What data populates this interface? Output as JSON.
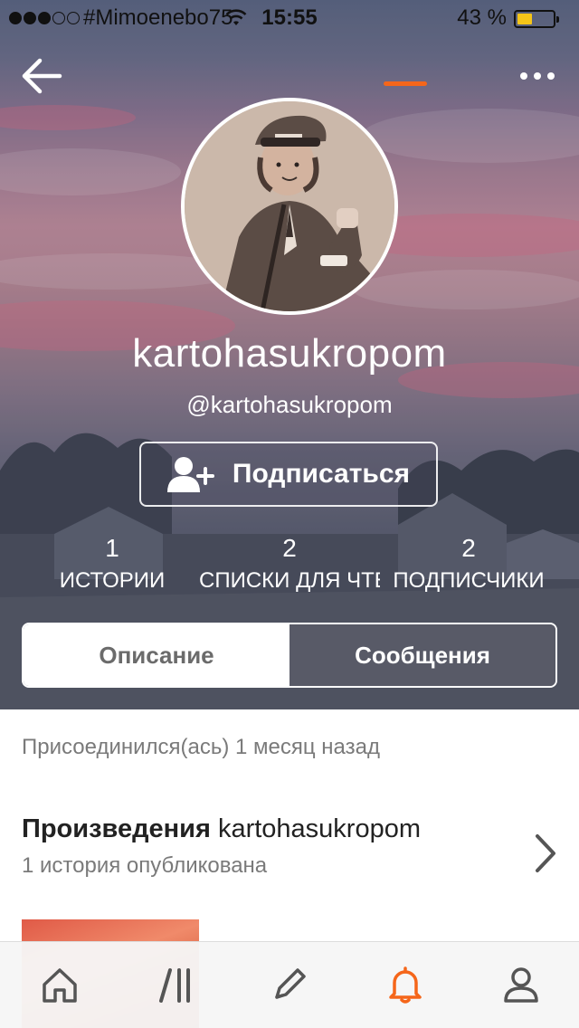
{
  "status_bar": {
    "carrier": "#Mimoenebo75",
    "time": "15:55",
    "battery_percent_text": "43 %",
    "battery_level": 0.43,
    "signal_bars": 3,
    "signal_total": 5
  },
  "profile": {
    "username": "kartohasukropom",
    "handle": "@kartohasukropom"
  },
  "follow_button": {
    "label": "Подписаться"
  },
  "stats": [
    {
      "value": "1",
      "label": "ИСТОРИИ"
    },
    {
      "value": "2",
      "label": "СПИСКИ ДЛЯ ЧТЕНИЯ"
    },
    {
      "value": "2",
      "label": "ПОДПИСЧИКИ"
    }
  ],
  "tabs": [
    {
      "label": "Описание",
      "active": false
    },
    {
      "label": "Сообщения",
      "active": true
    }
  ],
  "content": {
    "joined": "Присоединился(ась) 1 месяц назад",
    "works_prefix": "Произведения",
    "works_name": "kartohasukropom",
    "works_count": "1 история опубликована"
  },
  "tabbar": {
    "items": [
      "home-icon",
      "library-icon",
      "write-icon",
      "notifications-icon",
      "profile-icon"
    ],
    "active": "notifications-icon",
    "accent": "#f5661a"
  }
}
